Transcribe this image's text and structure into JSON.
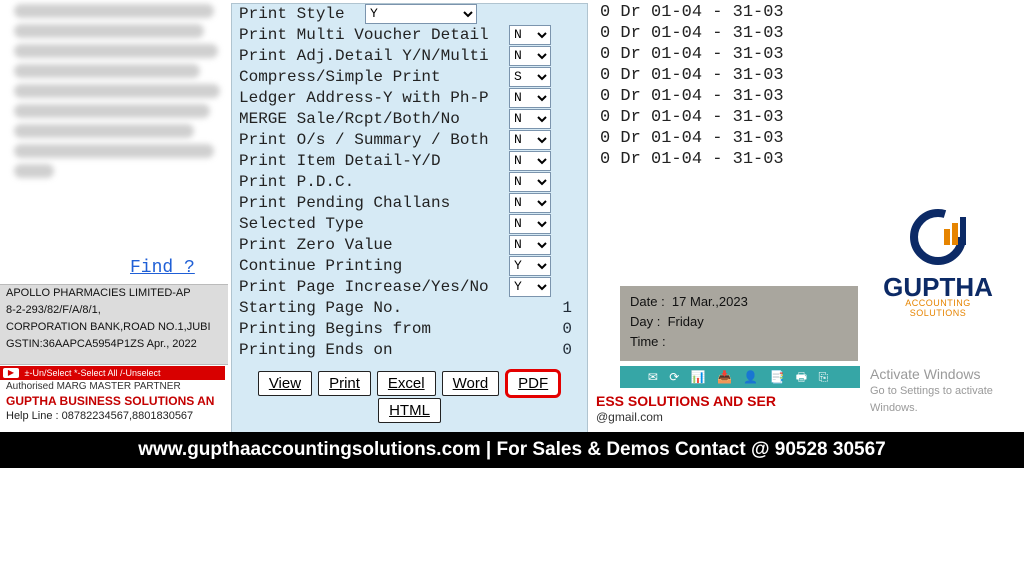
{
  "find_link": "Find ?",
  "info_panel": {
    "line1": "APOLLO PHARMACIES LIMITED-AP",
    "line2": "8-2-293/82/F/A/8/1,",
    "line3": "CORPORATION BANK,ROAD NO.1,JUBI",
    "line4": "GSTIN:36AAPCA5954P1ZS  Apr., 2022"
  },
  "red_bar": "±-Un/Select *-Select All /-Unselect",
  "authorised": "Authorised MARG MASTER PARTNER",
  "guptha_biz": "GUPTHA BUSINESS SOLUTIONS AN",
  "helpline": "Help Line : 08782234567,8801830567",
  "dialog": {
    "rows": [
      {
        "label": "Print Style",
        "kind": "wide",
        "value": "Y"
      },
      {
        "label": "Print Multi Voucher Detail",
        "kind": "sm",
        "value": "N"
      },
      {
        "label": "Print Adj.Detail Y/N/Multi",
        "kind": "sm",
        "value": "N"
      },
      {
        "label": "Compress/Simple Print",
        "kind": "sm",
        "value": "S"
      },
      {
        "label": "Ledger Address-Y with Ph-P",
        "kind": "sm",
        "value": "N"
      },
      {
        "label": "MERGE Sale/Rcpt/Both/No",
        "kind": "sm",
        "value": "N"
      },
      {
        "label": "Print O/s / Summary / Both",
        "kind": "sm",
        "value": "N"
      },
      {
        "label": "Print Item Detail-Y/D",
        "kind": "sm",
        "value": "N"
      },
      {
        "label": "Print P.D.C.",
        "kind": "sm",
        "value": "N"
      },
      {
        "label": "Print Pending Challans",
        "kind": "sm",
        "value": "N"
      },
      {
        "label": "Selected Type",
        "kind": "sm",
        "value": "N"
      },
      {
        "label": "Print Zero Value",
        "kind": "sm",
        "value": "N"
      },
      {
        "label": "Continue Printing",
        "kind": "sm",
        "value": "Y"
      },
      {
        "label": "Print Page Increase/Yes/No",
        "kind": "sm",
        "value": "Y"
      },
      {
        "label": "Starting Page No.",
        "kind": "num",
        "value": "1"
      },
      {
        "label": "Printing Begins from",
        "kind": "num",
        "value": "0"
      },
      {
        "label": "Printing Ends on",
        "kind": "num",
        "value": "0"
      }
    ],
    "buttons": [
      "View",
      "Print",
      "Excel",
      "Word",
      "PDF",
      "HTML"
    ],
    "highlight": "PDF"
  },
  "dr_line": "0 Dr 01-04 - 31-03",
  "dr_count": 8,
  "date_panel": {
    "date_lab": "Date  :",
    "date_val": "17 Mar.,2023",
    "day_lab": "Day   :",
    "day_val": "Friday",
    "time_lab": "Time :",
    "time_val": ""
  },
  "iconstrip_glyphs": "✉ ⟳ 📊 📥 👤 📑 🖶 ⎘",
  "ess_text": "ESS SOLUTIONS AND SER",
  "gmail_text": "@gmail.com",
  "logo": {
    "top": "G",
    "mid": "GUPTHA",
    "sub": "ACCOUNTING SOLUTIONS"
  },
  "activate": {
    "l1": "Activate Windows",
    "l2": "Go to Settings to activate Windows."
  },
  "footer": "www.gupthaaccountingsolutions.com | For Sales & Demos Contact @ 90528 30567"
}
